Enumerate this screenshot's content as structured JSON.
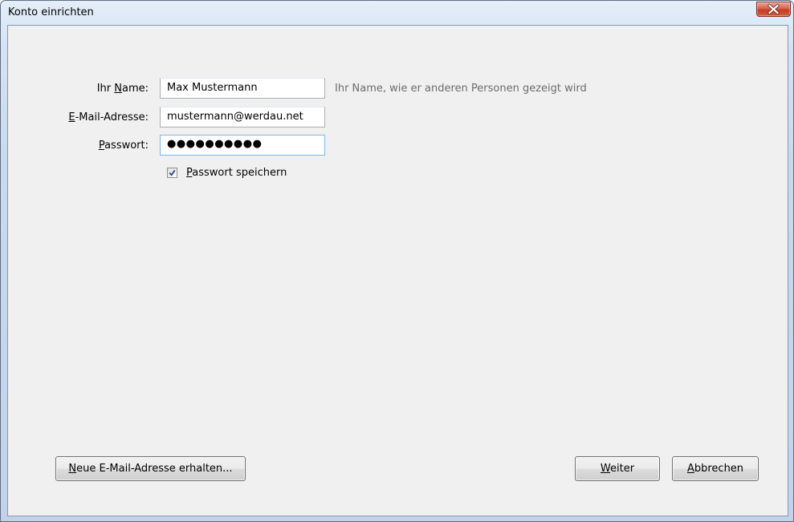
{
  "window": {
    "title": "Konto einrichten"
  },
  "form": {
    "name": {
      "label_pre": "Ihr ",
      "label_accel": "N",
      "label_post": "ame:",
      "value": "Max Mustermann",
      "hint": "Ihr Name, wie er anderen Personen gezeigt wird"
    },
    "email": {
      "label_pre": "",
      "label_accel": "E",
      "label_post": "-Mail-Adresse:",
      "value": "mustermann@werdau.net"
    },
    "password": {
      "label_pre": "",
      "label_accel": "P",
      "label_post": "asswort:",
      "masked_value": "●●●●●●●●●●"
    },
    "remember_password": {
      "checked": true,
      "label_pre": "",
      "label_accel": "P",
      "label_post": "asswort speichern"
    }
  },
  "buttons": {
    "new_email": {
      "label_pre": "",
      "label_accel": "N",
      "label_post": "eue E-Mail-Adresse erhalten..."
    },
    "continue": {
      "label_pre": "",
      "label_accel": "W",
      "label_post": "eiter"
    },
    "cancel": {
      "label_pre": "",
      "label_accel": "A",
      "label_post": "bbrechen"
    }
  },
  "icons": {
    "close": "close-icon",
    "check": "check-icon"
  },
  "colors": {
    "close_button": "#c23d22",
    "focus_border": "#7eb4ea",
    "hint_text": "#6d6d6d"
  }
}
